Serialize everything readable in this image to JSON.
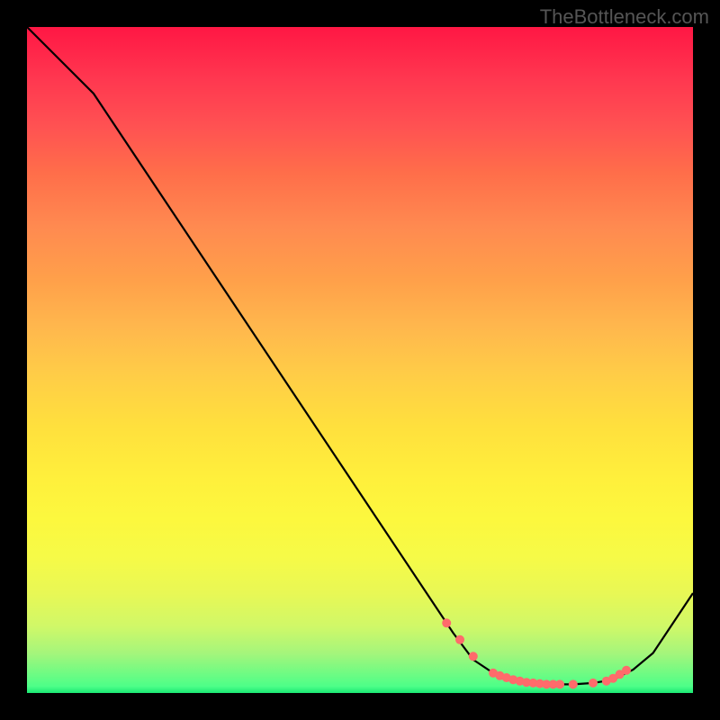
{
  "watermark": "TheBottleneck.com",
  "chart_data": {
    "type": "line",
    "title": "",
    "xlabel": "",
    "ylabel": "",
    "xlim": [
      0,
      100
    ],
    "ylim": [
      0,
      100
    ],
    "series": [
      {
        "name": "bottleneck-curve",
        "x": [
          0,
          6,
          10,
          20,
          30,
          40,
          50,
          60,
          64,
          67,
          70,
          73,
          76,
          79,
          82,
          85,
          88,
          91,
          94,
          100
        ],
        "values": [
          100,
          94,
          90,
          75,
          60,
          45,
          30,
          15,
          9,
          5,
          3,
          2,
          1.5,
          1.3,
          1.3,
          1.5,
          2,
          3.5,
          6,
          15
        ]
      }
    ],
    "markers": {
      "name": "highlight-points",
      "x": [
        63,
        65,
        67,
        70,
        71,
        72,
        73,
        74,
        75,
        76,
        77,
        78,
        79,
        80,
        82,
        85,
        87,
        88,
        89,
        90
      ],
      "values": [
        10.5,
        8,
        5.5,
        3,
        2.6,
        2.3,
        2.0,
        1.8,
        1.6,
        1.5,
        1.4,
        1.3,
        1.3,
        1.3,
        1.3,
        1.5,
        1.8,
        2.2,
        2.8,
        3.4
      ]
    },
    "gradient": {
      "top": "#ff1744",
      "mid": "#fff03c",
      "bottom": "#1ae873"
    }
  }
}
